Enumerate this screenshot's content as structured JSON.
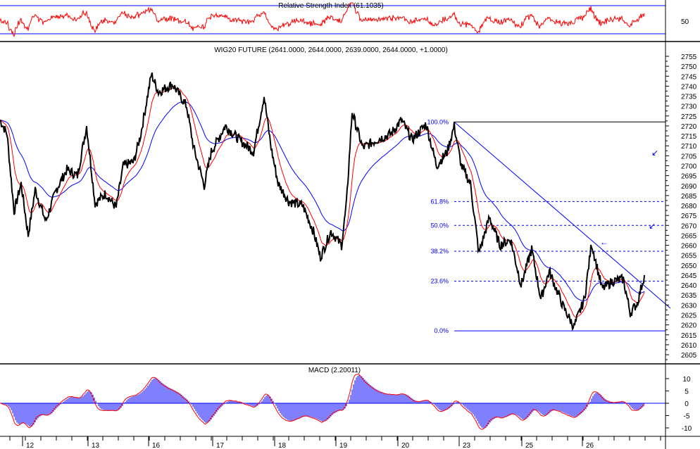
{
  "chart_data": {
    "type": "line",
    "rsi": {
      "title": "Relative Strength Index (61.1035)",
      "ticks": [
        50
      ]
    },
    "main": {
      "title": "WIG20 FUTURE (2641.0000, 2644.0000, 2639.0000, 2644.0000, +1.0000)",
      "ylim": [
        2600,
        2760
      ],
      "yticks": [
        2755,
        2750,
        2745,
        2740,
        2735,
        2730,
        2725,
        2720,
        2715,
        2710,
        2705,
        2700,
        2695,
        2690,
        2685,
        2680,
        2675,
        2670,
        2665,
        2660,
        2655,
        2650,
        2645,
        2640,
        2635,
        2630,
        2625,
        2620,
        2615,
        2610,
        2605
      ],
      "price": [
        [
          0,
          2723
        ],
        [
          10,
          2716
        ],
        [
          20,
          2677
        ],
        [
          30,
          2691
        ],
        [
          40,
          2665
        ],
        [
          50,
          2688
        ],
        [
          65,
          2672
        ],
        [
          80,
          2688
        ],
        [
          95,
          2698
        ],
        [
          110,
          2695
        ],
        [
          123,
          2720
        ],
        [
          135,
          2681
        ],
        [
          150,
          2686
        ],
        [
          165,
          2679
        ],
        [
          175,
          2700
        ],
        [
          190,
          2702
        ],
        [
          200,
          2716
        ],
        [
          215,
          2746
        ],
        [
          225,
          2737
        ],
        [
          245,
          2741
        ],
        [
          265,
          2730
        ],
        [
          275,
          2709
        ],
        [
          290,
          2690
        ],
        [
          300,
          2707
        ],
        [
          320,
          2720
        ],
        [
          340,
          2713
        ],
        [
          360,
          2707
        ],
        [
          375,
          2735
        ],
        [
          385,
          2709
        ],
        [
          395,
          2691
        ],
        [
          410,
          2682
        ],
        [
          430,
          2680
        ],
        [
          445,
          2667
        ],
        [
          455,
          2654
        ],
        [
          470,
          2667
        ],
        [
          485,
          2660
        ],
        [
          492,
          2681
        ],
        [
          500,
          2727
        ],
        [
          515,
          2709
        ],
        [
          535,
          2713
        ],
        [
          555,
          2716
        ],
        [
          570,
          2723
        ],
        [
          585,
          2713
        ],
        [
          605,
          2721
        ],
        [
          620,
          2700
        ],
        [
          635,
          2707
        ],
        [
          645,
          2720
        ],
        [
          655,
          2700
        ],
        [
          668,
          2691
        ],
        [
          680,
          2656
        ],
        [
          695,
          2674
        ],
        [
          710,
          2660
        ],
        [
          725,
          2663
        ],
        [
          740,
          2640
        ],
        [
          755,
          2658
        ],
        [
          768,
          2633
        ],
        [
          780,
          2647
        ],
        [
          800,
          2629
        ],
        [
          815,
          2619
        ],
        [
          830,
          2633
        ],
        [
          840,
          2661
        ],
        [
          855,
          2638
        ],
        [
          870,
          2642
        ],
        [
          885,
          2643
        ],
        [
          895,
          2626
        ],
        [
          905,
          2631
        ],
        [
          915,
          2645
        ]
      ],
      "fibonacci": [
        {
          "label": "100.0%",
          "value": 2722
        },
        {
          "label": "61.8%",
          "value": 2682
        },
        {
          "label": "50.0%",
          "value": 2670
        },
        {
          "label": "38.2%",
          "value": 2657
        },
        {
          "label": "23.6%",
          "value": 2642
        },
        {
          "label": "0.0%",
          "value": 2617
        }
      ]
    },
    "macd": {
      "title": "MACD (2.20011)",
      "yticks": [
        10,
        5,
        0,
        -5,
        -10
      ],
      "ylim": [
        -15,
        15
      ]
    },
    "xticks": [
      "12",
      "13",
      "16",
      "17",
      "18",
      "19",
      "20",
      "23",
      "25",
      "26"
    ],
    "colors": {
      "price": "#000000",
      "fast": "#ff0000",
      "slow": "#0000ff",
      "hist": "#0000ff"
    }
  }
}
